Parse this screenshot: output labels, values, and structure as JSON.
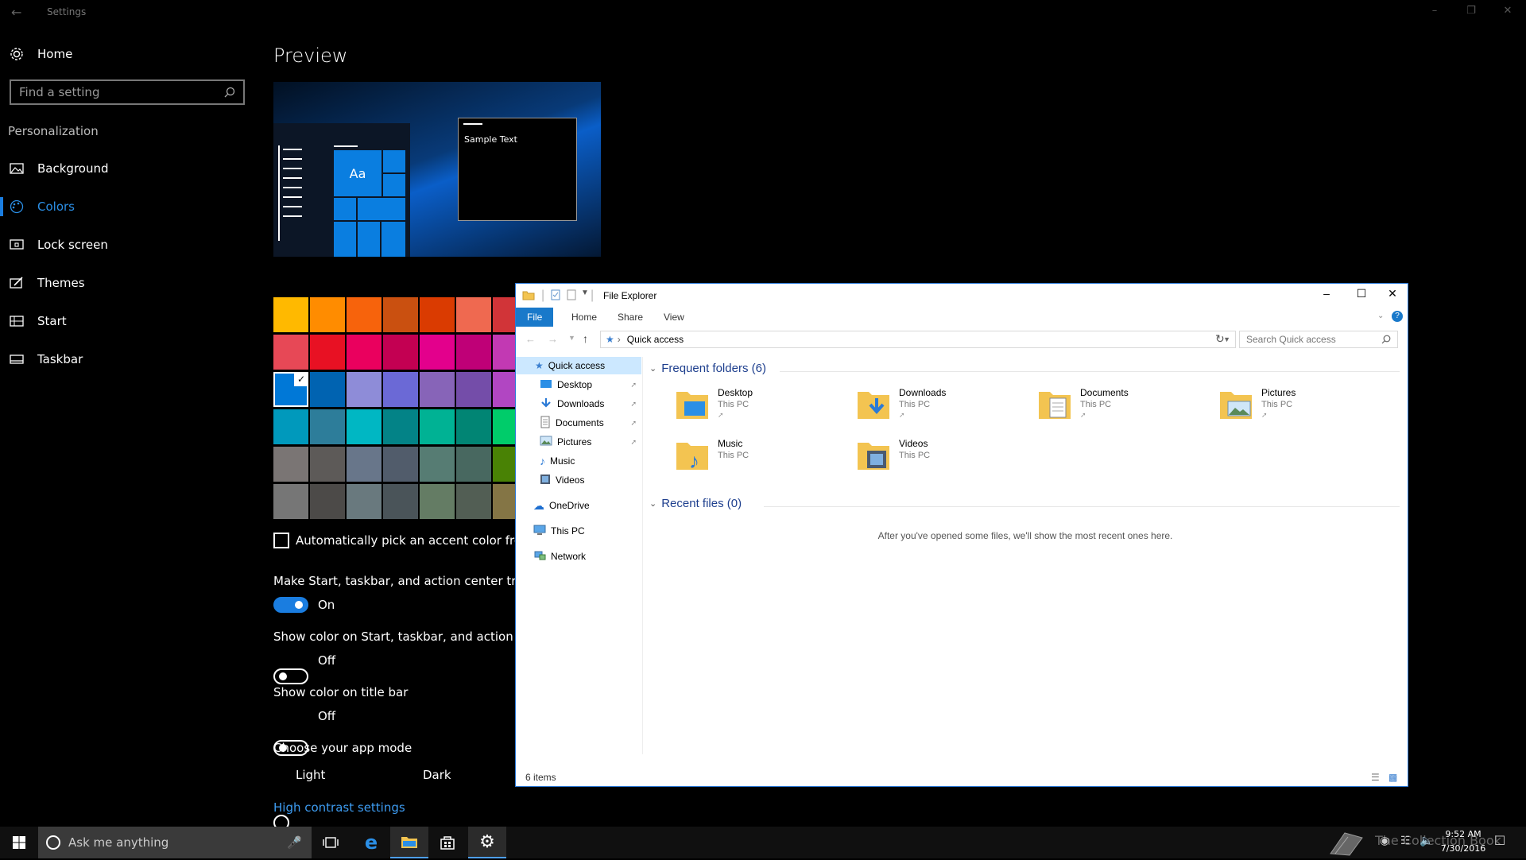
{
  "settings": {
    "title": "Settings",
    "home_label": "Home",
    "search_placeholder": "Find a setting",
    "section_label": "Personalization",
    "nav": [
      {
        "label": "Background",
        "icon": "picture-icon"
      },
      {
        "label": "Colors",
        "icon": "palette-icon",
        "active": true
      },
      {
        "label": "Lock screen",
        "icon": "lock-screen-icon"
      },
      {
        "label": "Themes",
        "icon": "brush-icon"
      },
      {
        "label": "Start",
        "icon": "start-grid-icon"
      },
      {
        "label": "Taskbar",
        "icon": "taskbar-icon"
      }
    ]
  },
  "colors": {
    "preview_heading": "Preview",
    "preview_tile_label": "Aa",
    "preview_sample_text": "Sample Text",
    "accent_selected": "#0078D7",
    "swatches": [
      [
        "#FFB900",
        "#FF8C00",
        "#F7630C",
        "#CA5010",
        "#DA3B01",
        "#EF6950",
        "#D13438"
      ],
      [
        "#E74856",
        "#E81123",
        "#EA005E",
        "#C30052",
        "#E3008C",
        "#BF0077",
        "#C239B3"
      ],
      [
        "#0078D7",
        "#0063B1",
        "#8E8CD8",
        "#6B69D6",
        "#8764B8",
        "#744DA9",
        "#B146C2"
      ],
      [
        "#0099BC",
        "#2D7D9A",
        "#00B7C3",
        "#038387",
        "#00B294",
        "#018574",
        "#00CC6A"
      ],
      [
        "#7A7574",
        "#5D5A58",
        "#68768A",
        "#515C6B",
        "#567C73",
        "#486860",
        "#498205"
      ],
      [
        "#767676",
        "#4C4A48",
        "#69797E",
        "#4A5459",
        "#647C64",
        "#525E54",
        "#847545"
      ]
    ],
    "auto_pick_label": "Automatically pick an accent color from my background",
    "transparent_label": "Make Start, taskbar, and action center transparent",
    "transparent_state": "On",
    "show_color_start_label": "Show color on Start, taskbar, and action center",
    "show_color_start_state": "Off",
    "show_color_title_label": "Show color on title bar",
    "show_color_title_state": "Off",
    "app_mode_label": "Choose your app mode",
    "mode_light": "Light",
    "mode_dark": "Dark",
    "high_contrast_link": "High contrast settings"
  },
  "explorer": {
    "title": "File Explorer",
    "ribbon_tabs": [
      "File",
      "Home",
      "Share",
      "View"
    ],
    "address": "Quick access",
    "search_placeholder": "Search Quick access",
    "nav": {
      "quick_access": "Quick access",
      "pinned": [
        "Desktop",
        "Downloads",
        "Documents",
        "Pictures"
      ],
      "unpinned": [
        "Music",
        "Videos"
      ],
      "onedrive": "OneDrive",
      "this_pc": "This PC",
      "network": "Network"
    },
    "frequent_header": "Frequent folders (6)",
    "folders": [
      {
        "name": "Desktop",
        "location": "This PC"
      },
      {
        "name": "Downloads",
        "location": "This PC"
      },
      {
        "name": "Documents",
        "location": "This PC"
      },
      {
        "name": "Pictures",
        "location": "This PC"
      },
      {
        "name": "Music",
        "location": "This PC"
      },
      {
        "name": "Videos",
        "location": "This PC"
      }
    ],
    "recent_header": "Recent files (0)",
    "recent_empty": "After you've opened some files, we'll show the most recent ones here.",
    "status": "6 items"
  },
  "taskbar": {
    "cortana_placeholder": "Ask me anything",
    "time": "9:52 AM",
    "date": "7/30/2016",
    "watermark": "The Collection Book"
  }
}
